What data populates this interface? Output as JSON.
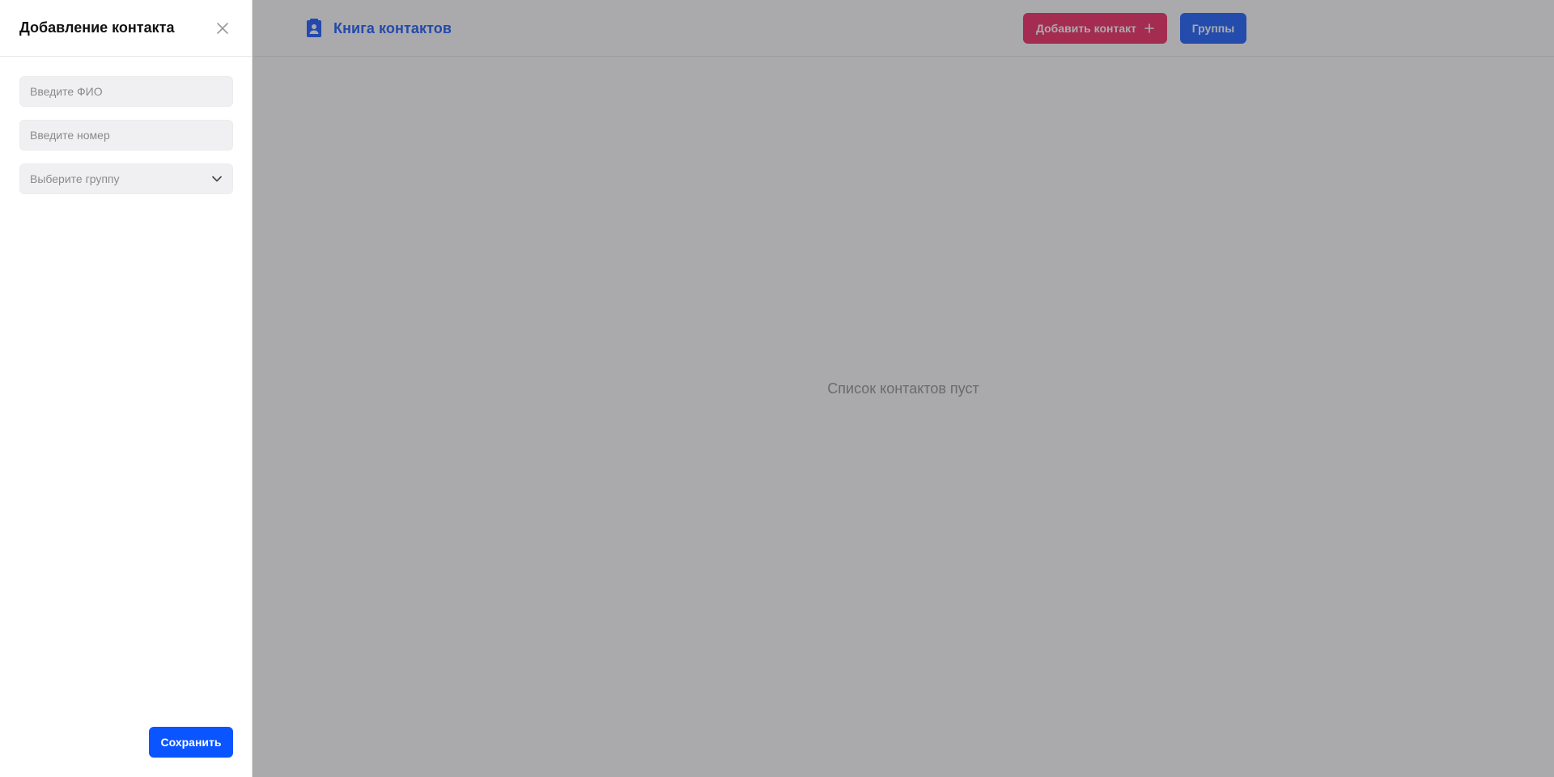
{
  "header": {
    "logo_text": "Книга контактов",
    "add_contact_label": "Добавить контакт",
    "groups_label": "Группы"
  },
  "main": {
    "empty_text": "Список контактов пуст"
  },
  "drawer": {
    "title": "Добавление контакта",
    "name_placeholder": "Введите ФИО",
    "phone_placeholder": "Введите номер",
    "group_placeholder": "Выберите группу",
    "save_label": "Сохранить"
  },
  "colors": {
    "brand_blue": "#0a55ff",
    "accent_pink": "#f41a5a",
    "overlay": "rgba(66,66,72,0.45)"
  },
  "icons": {
    "logo": "contact-book-icon",
    "plus": "plus-icon",
    "close": "close-icon",
    "chevron": "chevron-down-icon"
  }
}
